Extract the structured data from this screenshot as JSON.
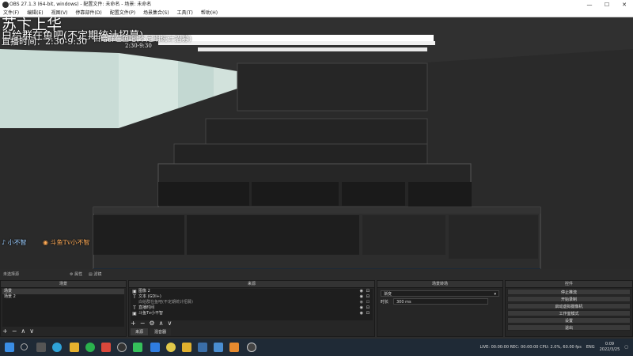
{
  "window": {
    "title": "OBS 27.1.3 (64-bit, windows) - 配置文件: 未命名 - 场景: 未命名",
    "controls": [
      "—",
      "☐",
      "✕"
    ]
  },
  "menu": [
    "文件(F)",
    "编辑(E)",
    "视图(V)",
    "停靠部件(D)",
    "配置文件(P)",
    "场景集合(S)",
    "工具(T)",
    "帮助(H)"
  ],
  "overlay": {
    "line1": "苏卞上华",
    "line2": "白给群在鱼吧(不定期统计招募)",
    "line3": "直播时间：2:30-9:30",
    "nested_line1": "白给群在鱼吧(不定期统计招募)",
    "nested_line2": "2:30-9:30",
    "tag_left": "小不智",
    "tag_right": "斗鱼Tv小不智"
  },
  "statusbar": {
    "label": "未选择源",
    "properties_btn": "属性",
    "filters_btn": "滤镜"
  },
  "scenes": {
    "title": "场景",
    "items": [
      "场景",
      "场景 2"
    ],
    "footer": [
      "+",
      "−",
      "∧",
      "∨"
    ]
  },
  "sources": {
    "title": "来源",
    "items": [
      {
        "icon": "▣",
        "name": "图像 2"
      },
      {
        "icon": "T",
        "name": "文本 (GDI+)"
      },
      {
        "icon": "",
        "name": "白给群在鱼吧(不定期统计招募)"
      },
      {
        "icon": "T",
        "name": "直播时间"
      },
      {
        "icon": "▣",
        "name": "斗鱼Tv小不智"
      }
    ],
    "footer": [
      "+",
      "−",
      "⚙",
      "∧",
      "∨"
    ],
    "tabs": [
      "来源",
      "混音器"
    ]
  },
  "transitions": {
    "title": "场景转场",
    "type": "渐变",
    "duration_label": "时长",
    "duration_value": "300 ms"
  },
  "controls": {
    "title": "控件",
    "buttons": [
      "停止推流",
      "开始录制",
      "启动虚拟摄像机",
      "工作室模式",
      "设置",
      "退出"
    ]
  },
  "tray": {
    "stats": "LIVE: 00:00:00  REC: 00:00:00  CPU: 2.0%, 60.00 fps",
    "lang": "ENG",
    "time": "0:09",
    "date": "2022/3/25"
  },
  "taskbar_icons": [
    "windows-start-icon",
    "search-icon",
    "taskview-icon",
    "edge-icon",
    "chrome-icon",
    "wechat-icon",
    "game-icon",
    "steam-icon",
    "mail-icon",
    "app-icon",
    "obs-icon"
  ]
}
